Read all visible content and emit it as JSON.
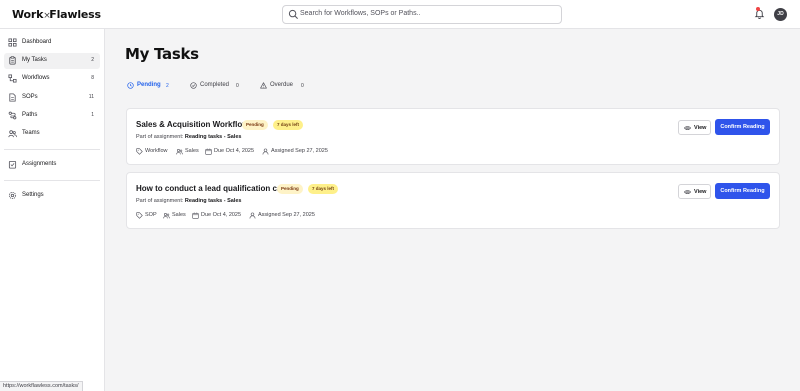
{
  "brand": {
    "left": "Work",
    "sep": "×",
    "right": "Flawless"
  },
  "search": {
    "placeholder": "Search for Workflows, SOPs or Paths.."
  },
  "user": {
    "initials": "JD"
  },
  "sidebar": {
    "items": [
      {
        "label": "Dashboard",
        "count": "",
        "icon": "grid-icon"
      },
      {
        "label": "My Tasks",
        "count": "2",
        "icon": "clipboard-icon"
      },
      {
        "label": "Workflows",
        "count": "8",
        "icon": "workflow-icon"
      },
      {
        "label": "SOPs",
        "count": "11",
        "icon": "document-icon"
      },
      {
        "label": "Paths",
        "count": "1",
        "icon": "path-icon"
      },
      {
        "label": "Teams",
        "count": "",
        "icon": "team-icon"
      },
      {
        "label": "Assignments",
        "count": "",
        "icon": "assignment-icon"
      },
      {
        "label": "Settings",
        "count": "",
        "icon": "gear-icon"
      }
    ]
  },
  "main": {
    "title": "My Tasks",
    "tabs": [
      {
        "label": "Pending",
        "count": "2",
        "icon": "clock-icon"
      },
      {
        "label": "Completed",
        "count": "0",
        "icon": "check-circle-icon"
      },
      {
        "label": "Overdue",
        "count": "0",
        "icon": "warning-icon"
      }
    ],
    "tasks": [
      {
        "title": "Sales & Acquisition Workflow",
        "status": "Pending",
        "days_left": "7 days left",
        "assignment_prefix": "Part of assignment:",
        "assignment_name": "Reading tasks - Sales",
        "type": "Workflow",
        "team": "Sales",
        "due": "Due Oct 4, 2025",
        "assigned": "Assigned Sep 27, 2025",
        "view_label": "View",
        "confirm_label": "Confirm Reading"
      },
      {
        "title": "How to conduct a lead qualification call",
        "status": "Pending",
        "days_left": "7 days left",
        "assignment_prefix": "Part of assignment:",
        "assignment_name": "Reading tasks - Sales",
        "type": "SOP",
        "team": "Sales",
        "due": "Due Oct 4, 2025",
        "assigned": "Assigned Sep 27, 2025",
        "view_label": "View",
        "confirm_label": "Confirm Reading"
      }
    ]
  },
  "statusbar": {
    "url": "https://workflawless.com/tasks/"
  },
  "colors": {
    "accent": "#2f54eb",
    "active_tab": "#2563eb",
    "pending_badge": "#fef3c7",
    "days_badge": "#fef08a"
  }
}
